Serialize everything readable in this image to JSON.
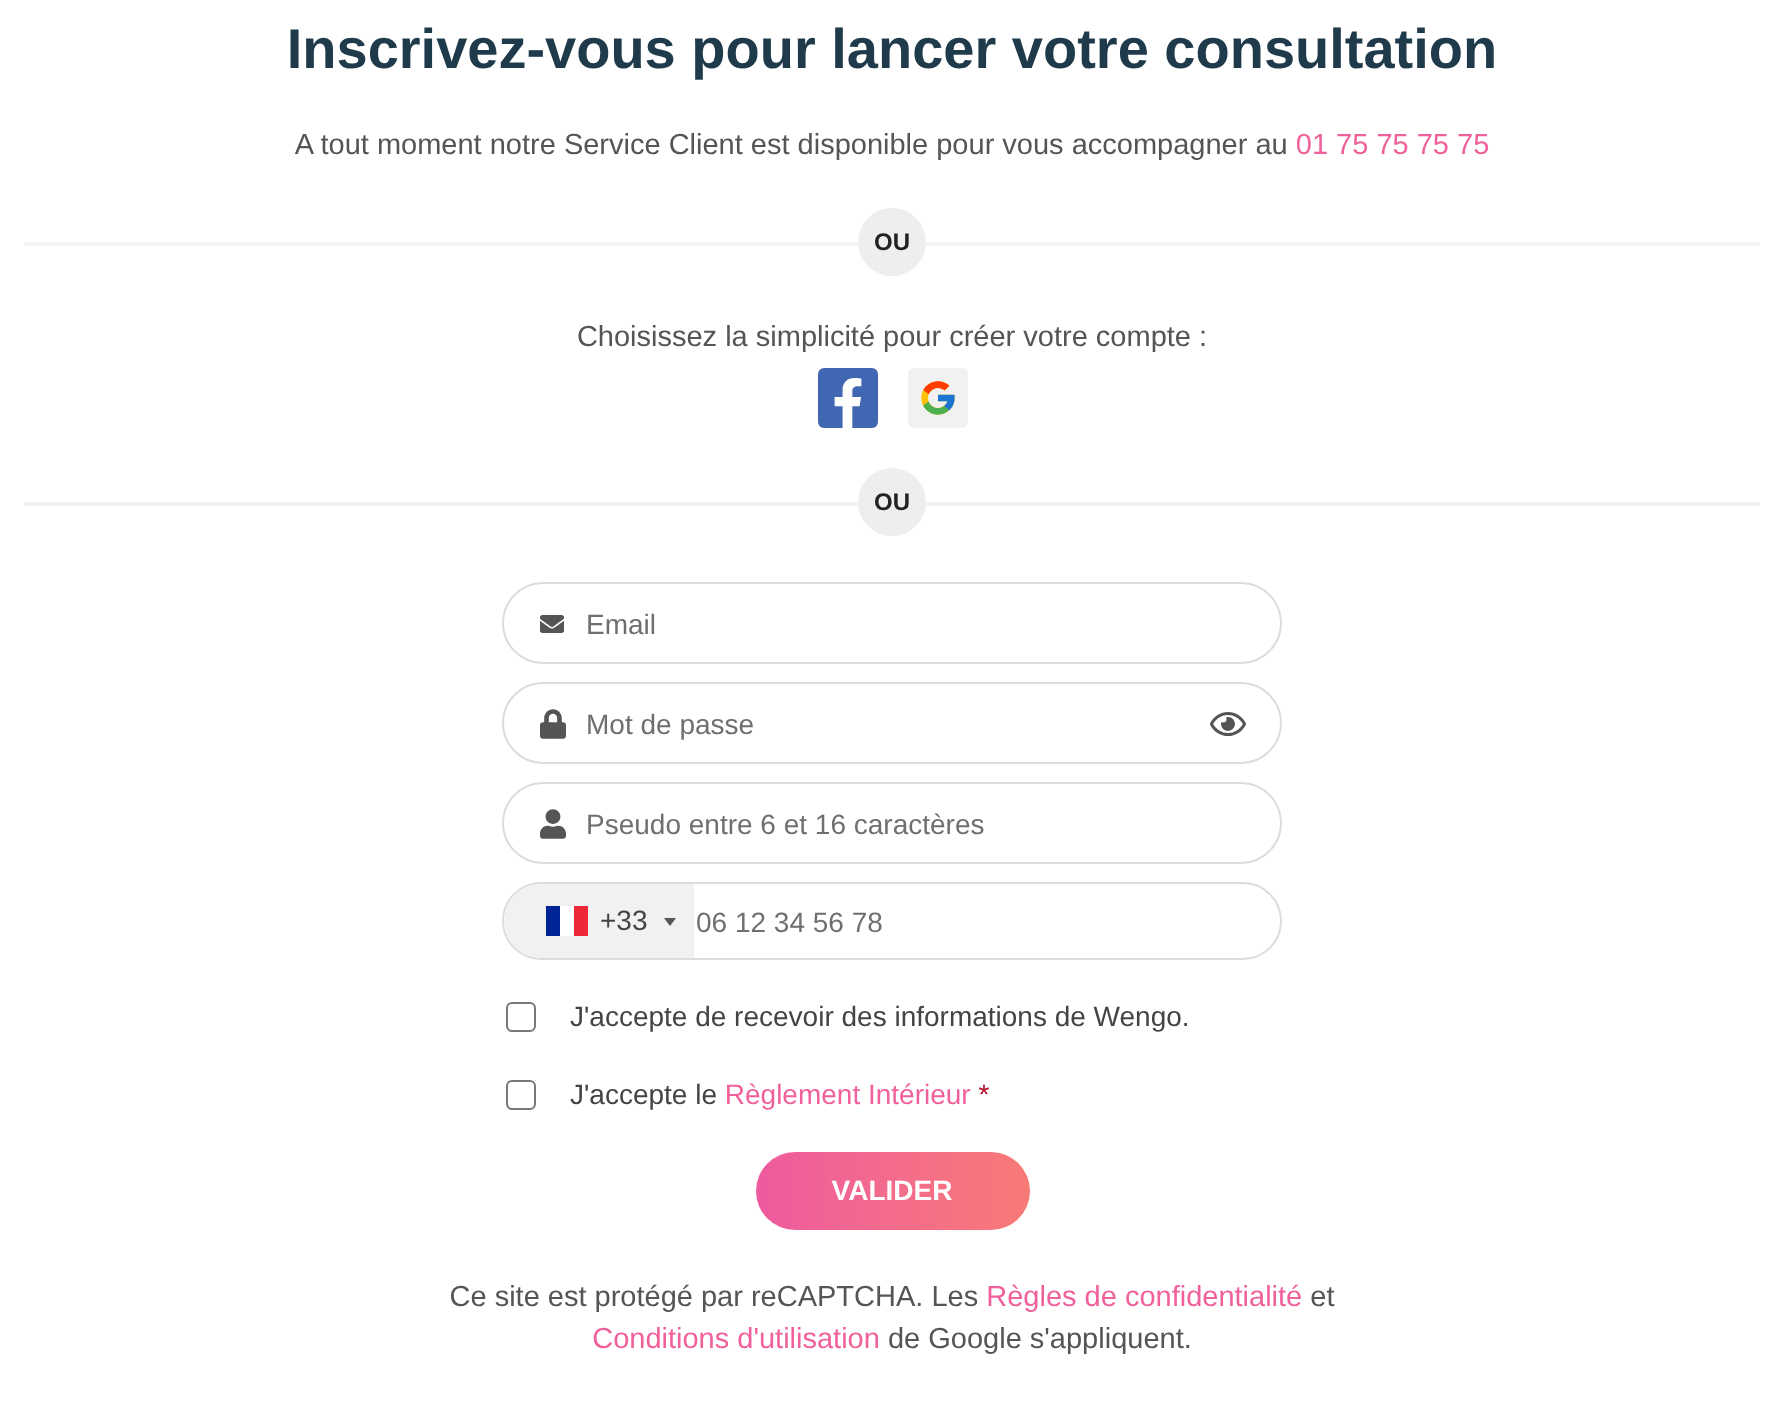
{
  "title": "Inscrivez-vous pour lancer votre consultation",
  "intro": {
    "segments": [
      {
        "kind": "text",
        "text": "A tout moment notre Service Client est disponible pour vous accompagner au"
      },
      {
        "kind": "link",
        "text": "01 75 75 75 75"
      }
    ]
  },
  "separator_top": {
    "label": "OU"
  },
  "social": {
    "prompt": "Choisissez la simplicité pour créer votre compte :",
    "buttons": [
      {
        "kind": "facebook"
      },
      {
        "kind": "google"
      }
    ]
  },
  "separator_bottom": {
    "label": "OU"
  },
  "fields": [
    {
      "kind": "email",
      "placeholder": "Email"
    },
    {
      "kind": "password",
      "placeholder": "Mot de passe"
    },
    {
      "kind": "username",
      "placeholder": "Pseudo entre 6 et 16 caractères"
    },
    {
      "kind": "phone",
      "country_code": "+33",
      "placeholder": "06 12 34 56 78"
    }
  ],
  "checkboxes": [
    {
      "checked": false,
      "segments": [
        {
          "kind": "text",
          "text": "J'accepte de recevoir des informations de Wengo."
        }
      ]
    },
    {
      "checked": false,
      "segments": [
        {
          "kind": "text",
          "text": "J'accepte le"
        },
        {
          "kind": "link",
          "text": "Règlement Intérieur"
        },
        {
          "kind": "required",
          "text": "*"
        }
      ]
    }
  ],
  "submit": {
    "label": "VALIDER"
  },
  "footer": {
    "segments": [
      {
        "kind": "text",
        "text": "Ce site est protégé par reCAPTCHA. Les"
      },
      {
        "kind": "link",
        "text": "Règles de confidentialité"
      },
      {
        "kind": "text",
        "text": "et"
      },
      {
        "kind": "link",
        "text": "Conditions d'utilisation"
      },
      {
        "kind": "text",
        "text": "de Google s'appliquent."
      }
    ]
  }
}
